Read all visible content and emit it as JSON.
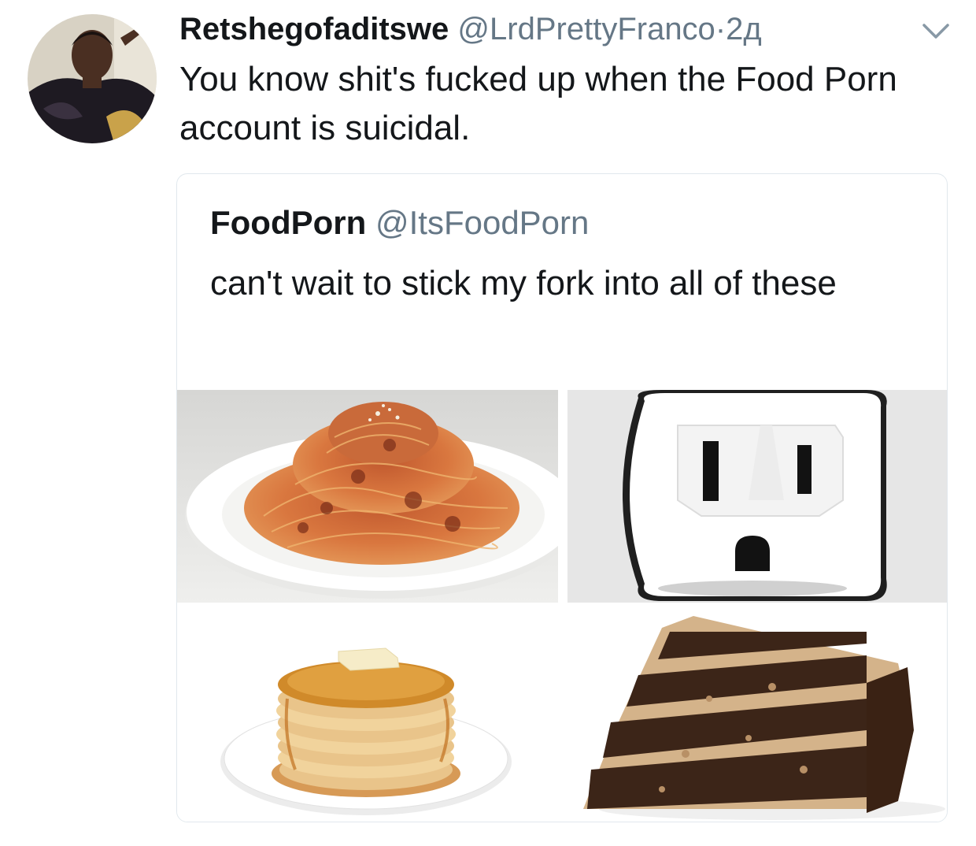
{
  "tweet": {
    "display_name": "Retshegofaditswe",
    "handle": "@LrdPrettyFranco",
    "separator": "·",
    "time": "2д",
    "text": "You know shit's fucked up when the Food Porn account is suicidal."
  },
  "quoted_tweet": {
    "display_name": "FoodPorn",
    "handle": "@ItsFoodPorn",
    "text": "can't wait to stick my fork into all of these",
    "images": [
      "spaghetti",
      "electrical-outlet",
      "pancakes",
      "chocolate-cake"
    ]
  },
  "icons": {
    "menu": "chevron-down-icon"
  },
  "colors": {
    "name": "#14171a",
    "secondary": "#657786",
    "border": "#e1e8ed"
  }
}
